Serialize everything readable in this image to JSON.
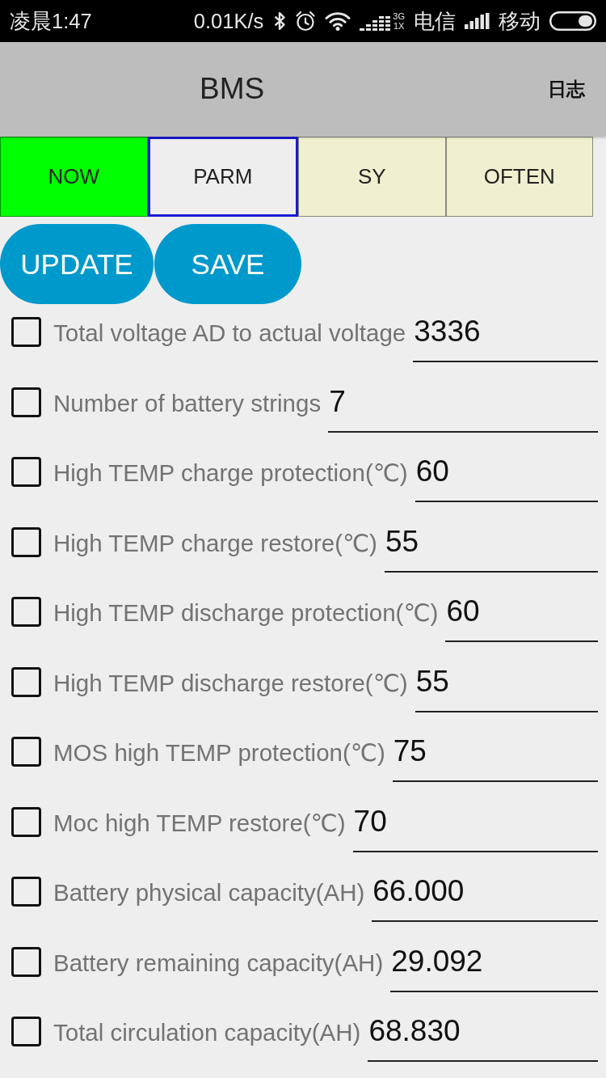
{
  "status_bar": {
    "time": "凌晨1:47",
    "net_speed": "0.01K/s",
    "network_type": [
      "3G",
      "1X"
    ],
    "carrier_1": "电信",
    "carrier_2": "移动"
  },
  "app_bar": {
    "title": "BMS",
    "action": "日志"
  },
  "tabs": [
    {
      "label": "NOW",
      "selected": false,
      "color": "#00ff00"
    },
    {
      "label": "PARM",
      "selected": true,
      "color": "#eeeeee"
    },
    {
      "label": "SY",
      "selected": false,
      "color": "#f0f0d0"
    },
    {
      "label": "OFTEN",
      "selected": false,
      "color": "#f0f0d0"
    }
  ],
  "buttons": [
    {
      "label": "UPDATE"
    },
    {
      "label": "SAVE"
    }
  ],
  "parameters": [
    {
      "label": "Total voltage AD to actual voltage",
      "value": "3336",
      "checked": false
    },
    {
      "label": "Number of battery strings",
      "value": "7",
      "checked": false
    },
    {
      "label": "High TEMP charge protection(℃)",
      "value": "60",
      "checked": false
    },
    {
      "label": "High TEMP charge restore(℃)",
      "value": "55",
      "checked": false
    },
    {
      "label": "High TEMP discharge protection(℃)",
      "value": "60",
      "checked": false
    },
    {
      "label": "High TEMP discharge restore(℃)",
      "value": "55",
      "checked": false
    },
    {
      "label": "MOS high TEMP protection(℃)",
      "value": "75",
      "checked": false
    },
    {
      "label": "Moc high TEMP restore(℃)",
      "value": "70",
      "checked": false
    },
    {
      "label": "Battery physical capacity(AH)",
      "value": "66.000",
      "checked": false
    },
    {
      "label": "Battery remaining capacity(AH)",
      "value": "29.092",
      "checked": false
    },
    {
      "label": "Total circulation capacity(AH)",
      "value": "68.830",
      "checked": false
    }
  ]
}
